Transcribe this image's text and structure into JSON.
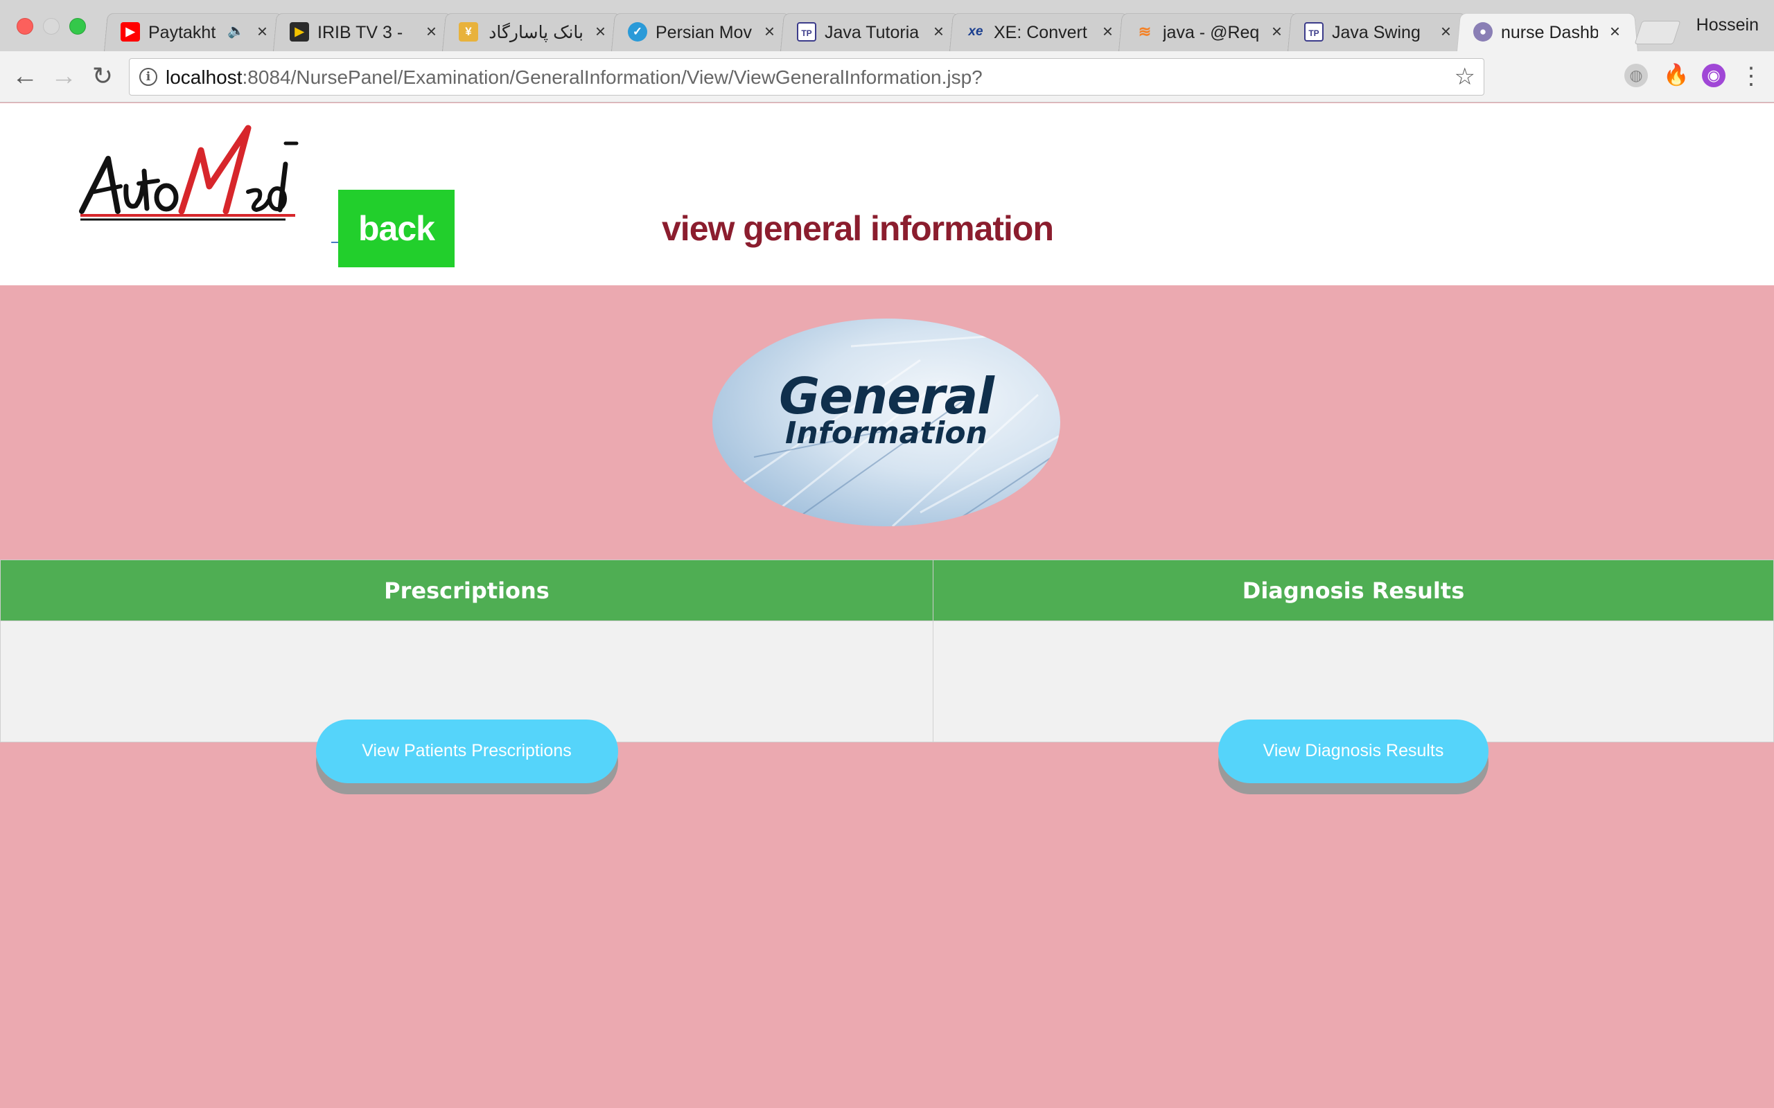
{
  "browser": {
    "tabs": [
      {
        "title": "Paytakht",
        "favicon": "youtube-icon",
        "favicon_color": "#ff0000",
        "audio": true,
        "active": false
      },
      {
        "title": "IRIB TV 3 - ",
        "favicon": "play-icon",
        "favicon_color": "#2b2b2b",
        "active": false
      },
      {
        "title": "بانک پاسارگاد ::",
        "favicon": "bank-icon",
        "favicon_color": "#e8b23c",
        "active": false
      },
      {
        "title": "Persian Mov",
        "favicon": "globe-icon",
        "favicon_color": "#2a9ad8",
        "active": false
      },
      {
        "title": "Java Tutoria",
        "favicon": "tutorial-icon",
        "favicon_color": "#3b3b8a",
        "active": false
      },
      {
        "title": "XE: Convert",
        "favicon": "xe-icon",
        "favicon_color": "#1b3f8f",
        "active": false
      },
      {
        "title": "java - @Req",
        "favicon": "stackoverflow-icon",
        "favicon_color": "#f48024",
        "active": false
      },
      {
        "title": "Java Swing",
        "favicon": "tutorial-icon",
        "favicon_color": "#3b3b8a",
        "active": false
      },
      {
        "title": "nurse Dashb",
        "favicon": "avatar-icon",
        "favicon_color": "#8a7fb5",
        "active": true
      }
    ],
    "profile_name": "Hossein",
    "url_host": "localhost",
    "url_rest": ":8084/NursePanel/Examination/GeneralInformation/View/ViewGeneralInformation.jsp?"
  },
  "header": {
    "logo_text": "AutoMed",
    "back_label": "back",
    "title": "view general information"
  },
  "banner": {
    "line1": "General",
    "line2": "Information"
  },
  "table": {
    "headers": [
      "Prescriptions",
      "Diagnosis Results"
    ],
    "buttons": [
      "View Patients Prescriptions",
      "View Diagnosis Results"
    ]
  },
  "colors": {
    "page_background": "#eba9b0",
    "back_button": "#22cf2c",
    "title": "#8b1d2e",
    "table_header": "#4fae53",
    "pill_button": "#55d4fa"
  }
}
